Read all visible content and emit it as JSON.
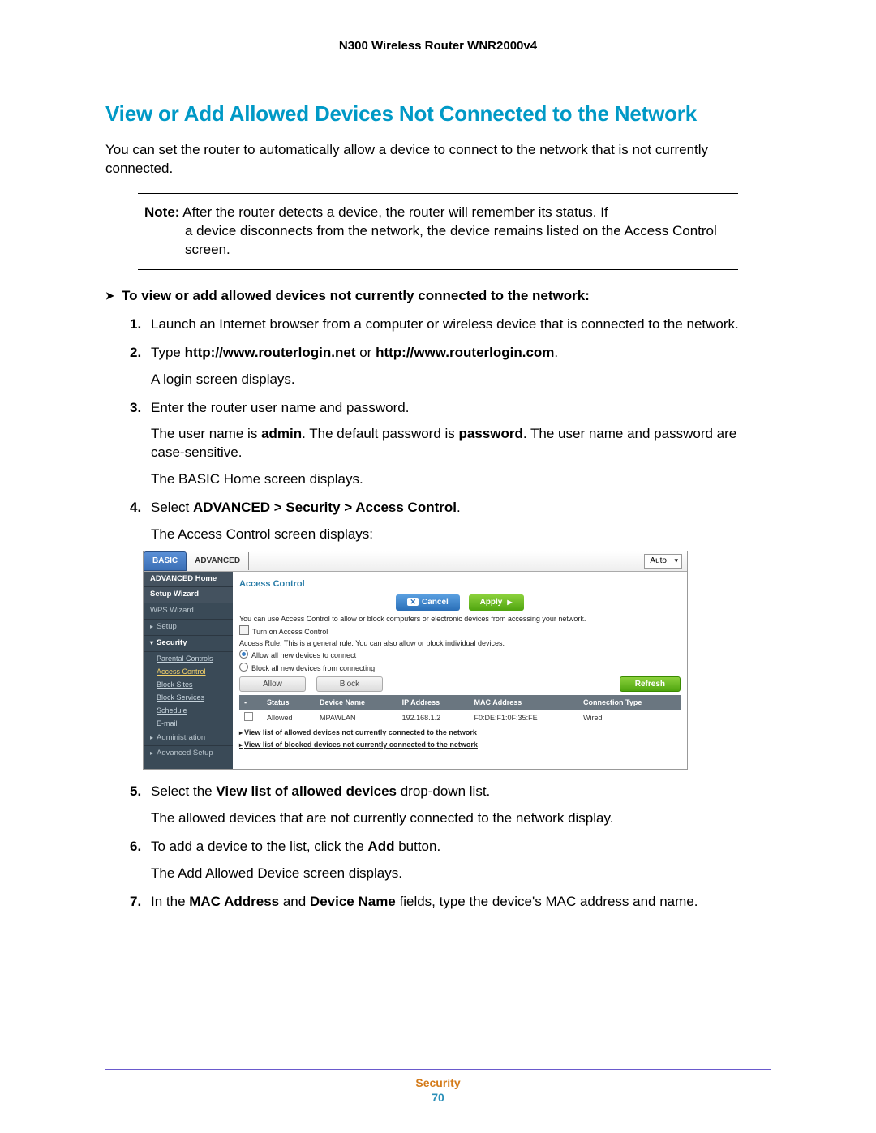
{
  "header": {
    "product": "N300 Wireless Router WNR2000v4"
  },
  "section": {
    "title": "View or Add Allowed Devices Not Connected to the Network",
    "intro": "You can set the router to automatically allow a device to connect to the network that is not currently connected.",
    "note_label": "Note:",
    "note_text": "After the router detects a device, the router will remember its status. If a device disconnects from the network, the device remains listed on the Access Control screen.",
    "task_heading": "To view or add allowed devices not currently connected to the network:"
  },
  "steps": {
    "s1": "Launch an Internet browser from a computer or wireless device that is connected to the network.",
    "s2_pre": "Type ",
    "s2_b1": "http://www.routerlogin.net",
    "s2_mid": " or ",
    "s2_b2": "http://www.routerlogin.com",
    "s2_post": ".",
    "s2_p": "A login screen displays.",
    "s3": "Enter the router user name and password.",
    "s3_p1a": "The user name is ",
    "s3_p1b": "admin",
    "s3_p1c": ". The default password is ",
    "s3_p1d": "password",
    "s3_p1e": ". The user name and password are case-sensitive.",
    "s3_p2": "The BASIC Home screen displays.",
    "s4_pre": "Select ",
    "s4_b": "ADVANCED > Security > Access Control",
    "s4_post": ".",
    "s4_p": "The Access Control screen displays:",
    "s5_pre": "Select the ",
    "s5_b": "View list of allowed devices",
    "s5_post": " drop-down list.",
    "s5_p": "The allowed devices that are not currently connected to the network display.",
    "s6_pre": "To add a device to the list, click the ",
    "s6_b": "Add",
    "s6_post": " button.",
    "s6_p": "The Add Allowed Device screen displays.",
    "s7_pre": "In the ",
    "s7_b1": "MAC Address",
    "s7_mid": " and ",
    "s7_b2": "Device Name",
    "s7_post": " fields, type the device's MAC address and name."
  },
  "ui": {
    "tabs": {
      "basic": "BASIC",
      "advanced": "ADVANCED",
      "auto": "Auto"
    },
    "side": {
      "adv_home": "ADVANCED Home",
      "setup_wiz": "Setup Wizard",
      "wps_wiz": "WPS Wizard",
      "setup": "Setup",
      "security": "Security",
      "parental": "Parental Controls",
      "access": "Access Control",
      "block_sites": "Block Sites",
      "block_serv": "Block Services",
      "schedule": "Schedule",
      "email": "E-mail",
      "admin": "Administration",
      "adv_setup": "Advanced Setup"
    },
    "main": {
      "title": "Access Control",
      "cancel": "Cancel",
      "apply": "Apply",
      "desc": "You can use Access Control to allow or block computers or electronic devices from accessing your network.",
      "turn_on": "Turn on Access Control",
      "rule": "Access Rule: This is a general rule. You can also allow or block individual devices.",
      "allow_new": "Allow all new devices to connect",
      "block_new": "Block all new devices from connecting",
      "allow_btn": "Allow",
      "block_btn": "Block",
      "refresh": "Refresh",
      "cols": {
        "status": "Status",
        "devname": "Device Name",
        "ip": "IP Address",
        "mac": "MAC Address",
        "ctype": "Connection Type"
      },
      "row": {
        "status": "Allowed",
        "devname": "MPAWLAN",
        "ip": "192.168.1.2",
        "mac": "F0:DE:F1:0F:35:FE",
        "ctype": "Wired"
      },
      "link1": "View list of allowed devices not currently connected to the network",
      "link2": "View list of blocked devices not currently connected to the network"
    }
  },
  "footer": {
    "section": "Security",
    "page": "70"
  }
}
